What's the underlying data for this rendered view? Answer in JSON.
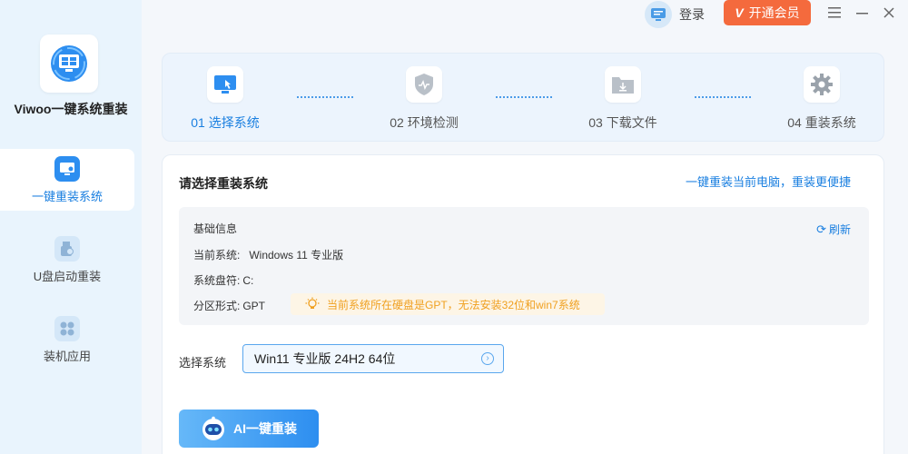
{
  "app": {
    "name": "Viwoo一键系统重装"
  },
  "sidebar": {
    "items": [
      {
        "label": "一键重装系统",
        "active": true
      },
      {
        "label": "U盘启动重装",
        "active": false
      },
      {
        "label": "装机应用",
        "active": false
      }
    ]
  },
  "topbar": {
    "login_label": "登录",
    "vip_badge": "V",
    "vip_label": "开通会员"
  },
  "steps": [
    {
      "label": "01 选择系统",
      "icon": "monitor-cursor-icon",
      "active": true
    },
    {
      "label": "02 环境检测",
      "icon": "shield-pulse-icon",
      "active": false
    },
    {
      "label": "03 下载文件",
      "icon": "folder-download-icon",
      "active": false
    },
    {
      "label": "04 重装系统",
      "icon": "gear-icon",
      "active": false
    }
  ],
  "main": {
    "title": "请选择重装系统",
    "link": "一键重装当前电脑，重装更便捷",
    "info": {
      "heading": "基础信息",
      "refresh_label": "刷新",
      "current_system_key": "当前系统:",
      "current_system_value": "Windows 11 专业版",
      "drive_key": "系统盘符:",
      "drive_value": "C:",
      "partition_key": "分区形式:",
      "partition_value": "GPT",
      "warning": "当前系统所在硬盘是GPT，无法安装32位和win7系统"
    },
    "select_label": "选择系统",
    "select_value": "Win11 专业版 24H2 64位",
    "ai_button": "AI一键重装"
  },
  "colors": {
    "accent": "#1a7fe0",
    "vip": "#f46a3d",
    "warning": "#f0a020"
  }
}
